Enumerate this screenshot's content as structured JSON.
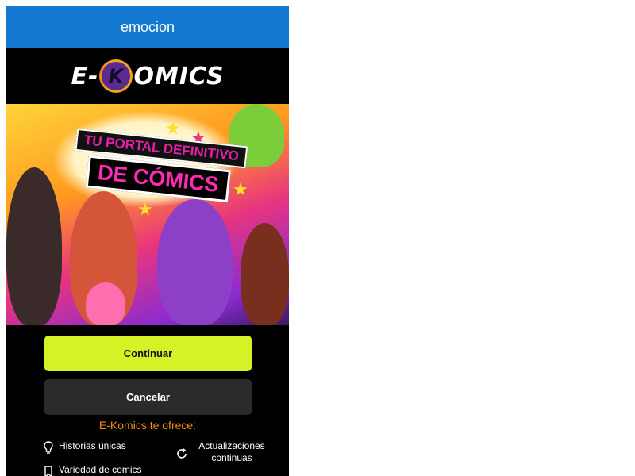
{
  "window": {
    "title": "emocion"
  },
  "brand": {
    "logo_left": "E-",
    "logo_k": "K",
    "logo_right": "OMICS"
  },
  "banner": {
    "line1": "TU PORTAL DEFINITIVO",
    "line2": "DE CÓMICS"
  },
  "actions": {
    "continue_label": "Continuar",
    "cancel_label": "Cancelar"
  },
  "offers": {
    "title": "E-Komics te ofrece:",
    "items": [
      {
        "label": "Historias únicas",
        "icon": "lightbulb-icon"
      },
      {
        "label": "Actualizaciones continuas",
        "icon": "refresh-icon"
      },
      {
        "label": "Variedad de comics",
        "icon": "bookmark-icon"
      }
    ]
  },
  "colors": {
    "titlebar": "#1479d1",
    "continue": "#d6f227",
    "cancel": "#2b2b2b",
    "accent": "#f28c0f"
  }
}
